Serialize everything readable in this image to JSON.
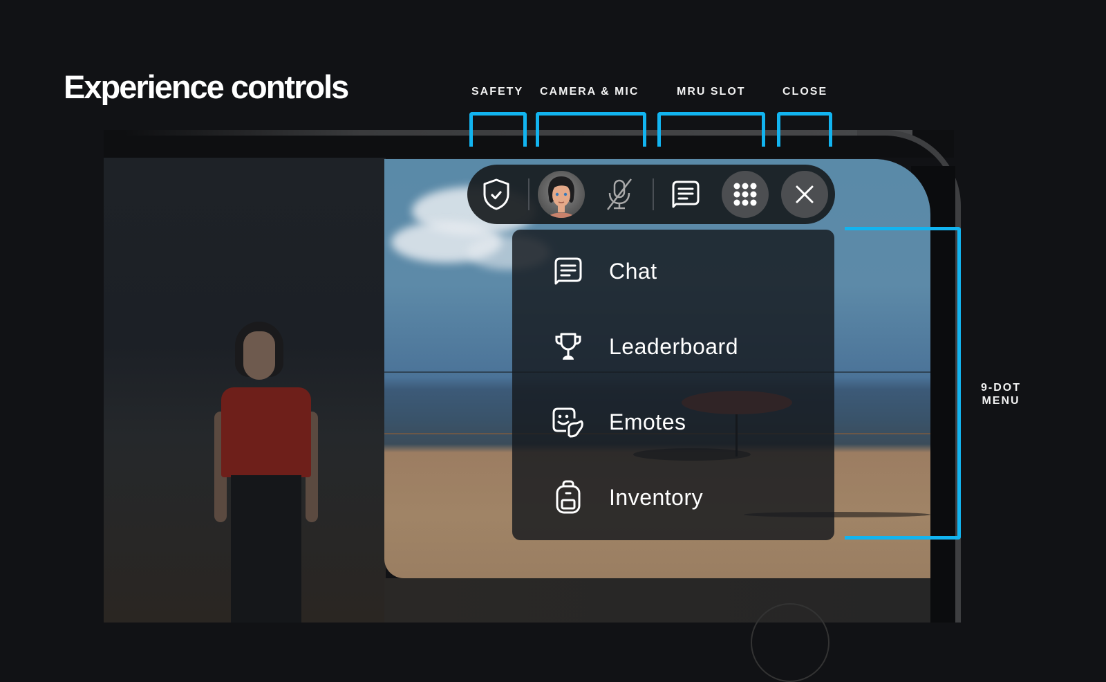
{
  "page": {
    "title": "Experience controls"
  },
  "annotations": {
    "top": [
      {
        "id": "safety",
        "label": "SAFETY"
      },
      {
        "id": "camera-mic",
        "label": "CAMERA & MIC"
      },
      {
        "id": "mru-slot",
        "label": "MRU SLOT"
      },
      {
        "id": "close",
        "label": "CLOSE"
      }
    ],
    "side": {
      "line1": "9-DOT",
      "line2": "MENU"
    },
    "accent_color": "#12b4f0"
  },
  "toolbar": {
    "buttons": [
      {
        "id": "safety",
        "icon": "shield-check-icon"
      },
      {
        "id": "self-view",
        "icon": "avatar"
      },
      {
        "id": "mic",
        "icon": "mic-off-icon"
      },
      {
        "id": "mru-chat",
        "icon": "chat-icon"
      },
      {
        "id": "nine-dot",
        "icon": "nine-dot-grid-icon"
      },
      {
        "id": "close",
        "icon": "close-icon"
      }
    ]
  },
  "menu": {
    "items": [
      {
        "label": "Chat",
        "icon": "chat-icon"
      },
      {
        "label": "Leaderboard",
        "icon": "trophy-icon"
      },
      {
        "label": "Emotes",
        "icon": "emote-icon"
      },
      {
        "label": "Inventory",
        "icon": "backpack-icon"
      }
    ]
  }
}
